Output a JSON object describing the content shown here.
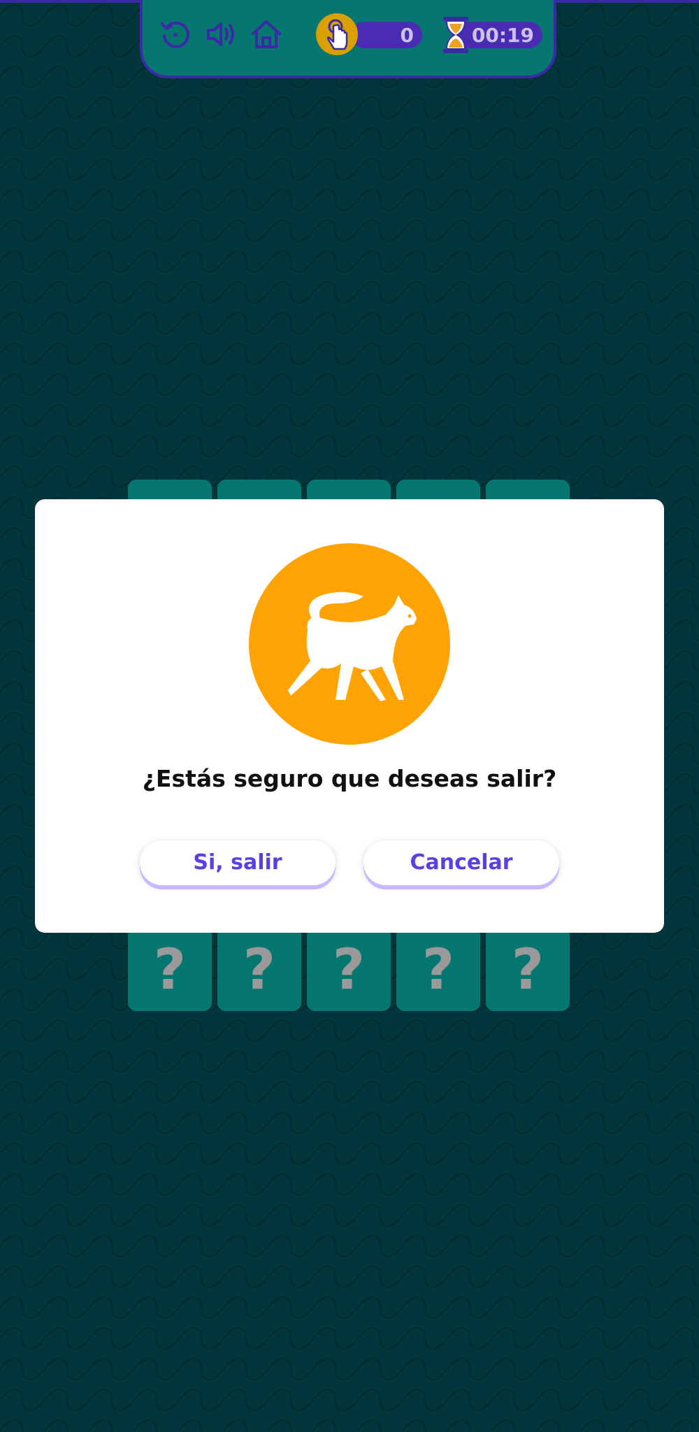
{
  "hud": {
    "buttons": [
      {
        "name": "restart",
        "icon": "restart-icon"
      },
      {
        "name": "sound",
        "icon": "speaker-icon"
      },
      {
        "name": "home",
        "icon": "home-icon"
      }
    ],
    "taps_count": "0",
    "timer": "00:19",
    "colors": {
      "panel": "#067670",
      "border": "#3b2aa6",
      "pill": "#4a2bb3",
      "coin": "#d9a000"
    }
  },
  "cards": {
    "hidden_symbol": "?",
    "top_row_count": 5,
    "bottom_row_count": 5
  },
  "modal": {
    "icon": "cat-icon",
    "question": "¿Estás seguro que deseas salir?",
    "confirm_label": "Si, salir",
    "cancel_label": "Cancelar",
    "colors": {
      "icon_bg": "#ffa305",
      "button_text": "#5b3ee6"
    }
  }
}
